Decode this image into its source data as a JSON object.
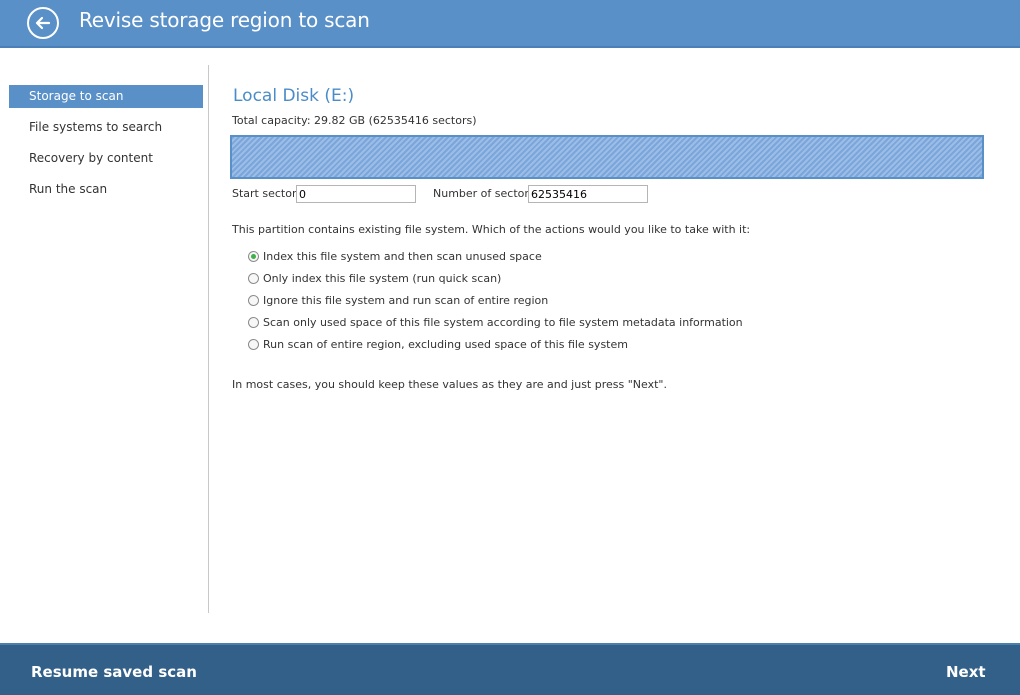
{
  "header": {
    "title": "Revise storage region to scan",
    "back_icon": "arrow-left-circle-icon"
  },
  "sidebar": {
    "items": [
      {
        "label": "Storage to scan",
        "active": true
      },
      {
        "label": "File systems to search",
        "active": false
      },
      {
        "label": "Recovery by content",
        "active": false
      },
      {
        "label": "Run the scan",
        "active": false
      }
    ]
  },
  "main": {
    "disk_title": "Local Disk (E:)",
    "capacity_text": "Total capacity: 29.82 GB (62535416 sectors)",
    "region_fill": 1.0,
    "start_sector_label": "Start sector:",
    "start_sector_value": "0",
    "num_sectors_label": "Number of sectors:",
    "num_sectors_value": "62535416",
    "question": "This partition contains existing file system. Which of the actions would you like to take with it:",
    "options": [
      {
        "label": "Index this file system and then scan unused space",
        "checked": true
      },
      {
        "label": "Only index this file system (run quick scan)",
        "checked": false
      },
      {
        "label": "Ignore this file system and run scan of entire region",
        "checked": false
      },
      {
        "label": "Scan only used space of this file system according to file system metadata information",
        "checked": false
      },
      {
        "label": "Run scan of entire region, excluding used space of this file system",
        "checked": false
      }
    ],
    "hint": "In most cases, you should keep these values as they are and just press \"Next\"."
  },
  "footer": {
    "resume_label": "Resume saved scan",
    "next_label": "Next"
  },
  "colors": {
    "header_bg": "#5a90c8",
    "footer_bg": "#336089",
    "accent": "#4a8cc8",
    "radio_checked": "#3fb04a"
  }
}
